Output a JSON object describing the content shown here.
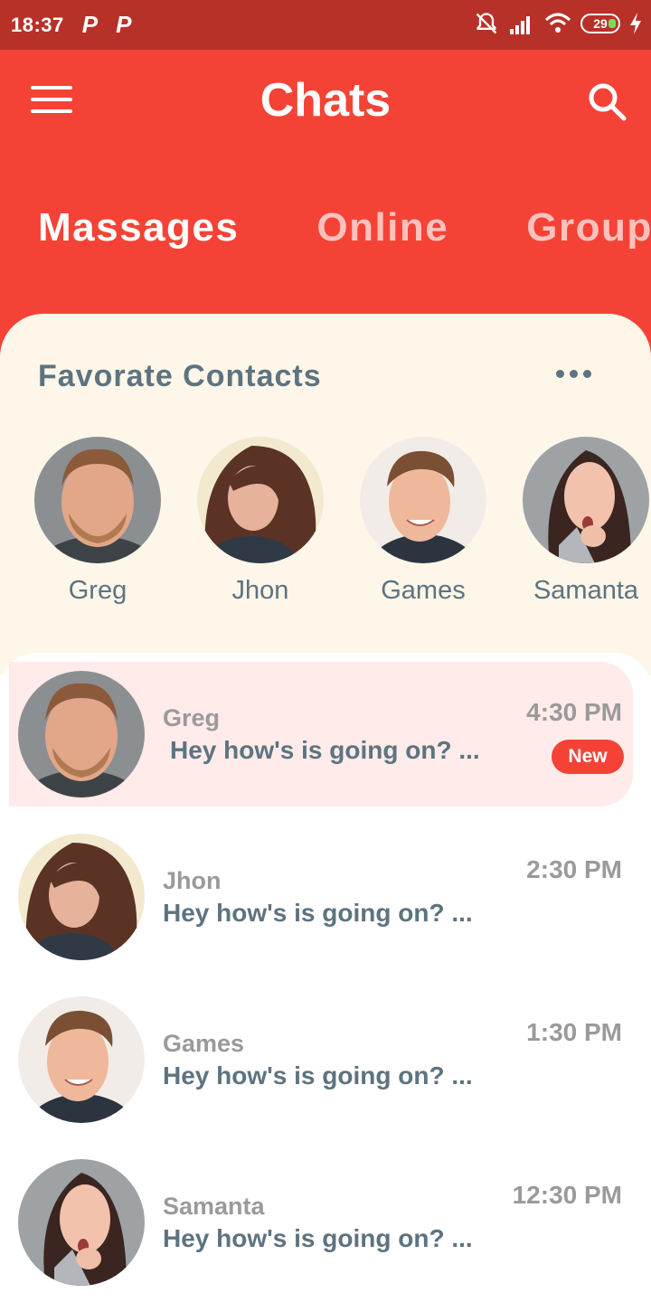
{
  "status_bar": {
    "time": "18:37",
    "notif1": "P",
    "notif2": "P",
    "battery": "29"
  },
  "header": {
    "title": "Chats",
    "tabs": [
      {
        "label": "Massages",
        "active": true
      },
      {
        "label": "Online",
        "active": false
      },
      {
        "label": "Groups",
        "active": false
      }
    ]
  },
  "favorites": {
    "title": "Favorate Contacts",
    "contacts": [
      {
        "name": "Greg"
      },
      {
        "name": "Jhon"
      },
      {
        "name": "Games"
      },
      {
        "name": "Samanta"
      }
    ]
  },
  "chats": [
    {
      "name": "Greg",
      "message": "Hey how's is going on? ...",
      "time": "4:30 PM",
      "badge": "New",
      "unread": true
    },
    {
      "name": "Jhon",
      "message": "Hey how's is going on? ...",
      "time": "2:30 PM"
    },
    {
      "name": "Games",
      "message": "Hey how's is going on? ...",
      "time": "1:30 PM"
    },
    {
      "name": "Samanta",
      "message": "Hey how's is going on? ...",
      "time": "12:30 PM"
    }
  ],
  "colors": {
    "accent": "#f44336",
    "status_bar": "#b83128",
    "panel": "#fdf6e9",
    "highlight": "#feebea",
    "text_slate": "#5d7380"
  },
  "icons": [
    "menu-icon",
    "search-icon",
    "more-icon",
    "silent-icon",
    "signal-icon",
    "wifi-icon",
    "battery-icon",
    "charging-icon"
  ]
}
